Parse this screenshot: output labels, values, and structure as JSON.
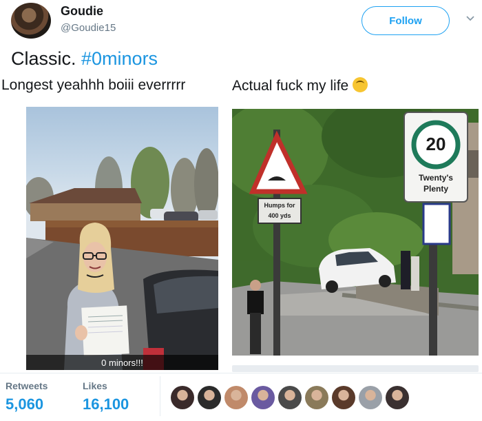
{
  "user": {
    "name": "Goudie",
    "handle": "@Goudie15",
    "follow_label": "Follow"
  },
  "tweet": {
    "text_prefix": "Classic. ",
    "hashtag": "#0minors"
  },
  "photos": [
    {
      "caption": "Longest yeahhh boiii everrrrr",
      "overlay_text": "0 minors!!!"
    },
    {
      "caption": "Actual fuck my life",
      "emoji": "upside-down-face-emoji",
      "sign_speed": "20",
      "sign_speed_text": "Twenty's Plenty",
      "sign_humps": "Humps for 400 yds"
    }
  ],
  "stats": {
    "retweets_label": "Retweets",
    "retweets_value": "5,060",
    "likes_label": "Likes",
    "likes_value": "16,100"
  },
  "likers": [
    "#3a2a2a",
    "#2b2b2b",
    "#c08a6a",
    "#6a5aa0",
    "#4a4a4a",
    "#8a7a5a",
    "#5a3a2a",
    "#9aa0a8",
    "#3a3030"
  ],
  "colors": {
    "accent": "#1da1f2",
    "hashtag": "#1b95e0",
    "muted": "#657786"
  }
}
